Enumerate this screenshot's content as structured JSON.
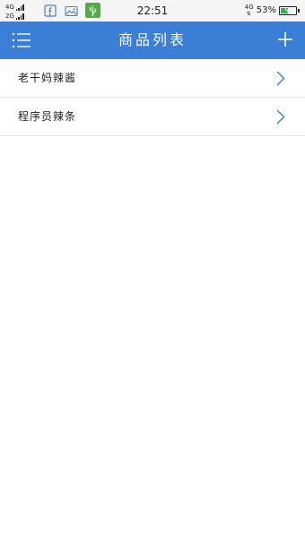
{
  "status_bar": {
    "network_1": "4G",
    "network_2": "2G",
    "time": "22:51",
    "network_right": "4G",
    "battery_percent": "53%",
    "battery_level": 0.53,
    "notification_icons": [
      "facebook-icon",
      "image-icon",
      "usb-icon"
    ]
  },
  "nav": {
    "title": "商品列表",
    "menu_icon": "menu-list-icon",
    "add_icon": "plus-icon"
  },
  "items": [
    {
      "label": "老干妈辣酱"
    },
    {
      "label": "程序员辣条"
    }
  ],
  "colors": {
    "nav_background": "#3b7ed5",
    "chevron": "#3b7ed5",
    "divider": "#e6e6e6",
    "usb_badge": "#4caf3e",
    "battery_fill": "#34b34a"
  }
}
